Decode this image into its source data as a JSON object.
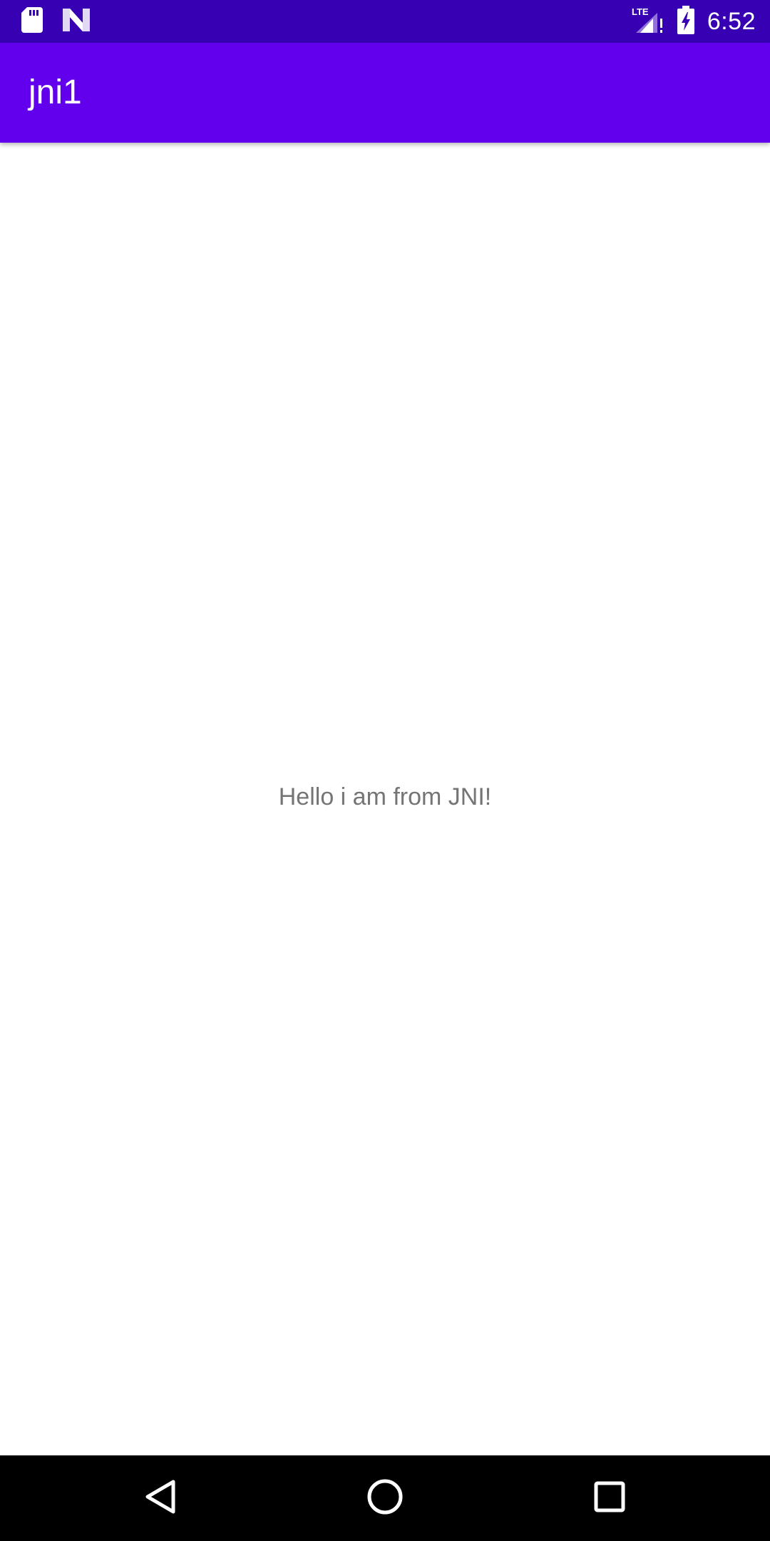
{
  "status_bar": {
    "time": "6:52",
    "network_label": "LTE",
    "icons": [
      "sd-card-icon",
      "n-logo-icon",
      "signal-lte-icon",
      "battery-charging-icon"
    ]
  },
  "app_bar": {
    "title": "jni1",
    "color": "#6200ee"
  },
  "status_bar_color": "#3700b3",
  "main": {
    "message": "Hello i am from JNI!"
  },
  "nav_bar": {
    "buttons": [
      "back-icon",
      "home-icon",
      "recents-icon"
    ]
  }
}
